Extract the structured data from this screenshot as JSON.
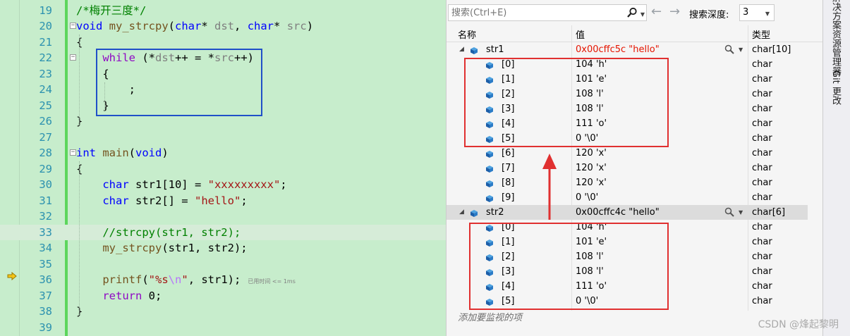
{
  "editor": {
    "lines": [
      {
        "n": "19",
        "html": "<span class='cm'>/*梅开三度*/</span>"
      },
      {
        "n": "20",
        "html": "<span class='kw'>void</span> <span class='fn'>my_strcpy</span>(<span class='kw'>char</span>* <span class='id'>dst</span>, <span class='kw'>char</span>* <span class='id'>src</span>)"
      },
      {
        "n": "21",
        "html": "{"
      },
      {
        "n": "22",
        "html": "    <span class='kw2'>while</span> (*<span class='id'>dst</span>++ = *<span class='id'>src</span>++)"
      },
      {
        "n": "23",
        "html": "    {"
      },
      {
        "n": "24",
        "html": "        ;"
      },
      {
        "n": "25",
        "html": "    }"
      },
      {
        "n": "26",
        "html": "}"
      },
      {
        "n": "27",
        "html": ""
      },
      {
        "n": "28",
        "html": "<span class='kw'>int</span> <span class='fn'>main</span>(<span class='kw'>void</span>)"
      },
      {
        "n": "29",
        "html": "{"
      },
      {
        "n": "30",
        "html": "    <span class='kw'>char</span> str1[10] = <span class='str'>\"xxxxxxxxx\"</span>;"
      },
      {
        "n": "31",
        "html": "    <span class='kw'>char</span> str2[] = <span class='str'>\"hello\"</span>;"
      },
      {
        "n": "32",
        "html": ""
      },
      {
        "n": "33",
        "html": "    <span class='cm'>//strcpy(str1, str2);</span>"
      },
      {
        "n": "34",
        "html": "    <span class='fn'>my_strcpy</span>(str1, str2);"
      },
      {
        "n": "35",
        "html": ""
      },
      {
        "n": "36",
        "html": "    <span class='fn'>printf</span>(<span class='str'>\"%s<span class='esc'>\\n</span>\"</span>, str1);<span class='hint'>已用时间 &lt;= 1ms</span>"
      },
      {
        "n": "37",
        "html": "    <span class='kw2'>return</span> 0;"
      },
      {
        "n": "38",
        "html": "}"
      },
      {
        "n": "39",
        "html": ""
      }
    ]
  },
  "watch": {
    "search_placeholder": "搜索(Ctrl+E)",
    "depth_label": "搜索深度:",
    "depth_value": "3",
    "columns": {
      "name": "名称",
      "value": "值",
      "type": "类型"
    },
    "rows": [
      {
        "level": 0,
        "name": "str1",
        "value": "0x00cffc5c \"hello\"",
        "type": "char[10]",
        "changed": true,
        "expanded": true,
        "selected": false
      },
      {
        "level": 1,
        "name": "[0]",
        "value": "104 'h'",
        "type": "char"
      },
      {
        "level": 1,
        "name": "[1]",
        "value": "101 'e'",
        "type": "char"
      },
      {
        "level": 1,
        "name": "[2]",
        "value": "108 'l'",
        "type": "char"
      },
      {
        "level": 1,
        "name": "[3]",
        "value": "108 'l'",
        "type": "char"
      },
      {
        "level": 1,
        "name": "[4]",
        "value": "111 'o'",
        "type": "char"
      },
      {
        "level": 1,
        "name": "[5]",
        "value": "0 '\\0'",
        "type": "char"
      },
      {
        "level": 1,
        "name": "[6]",
        "value": "120 'x'",
        "type": "char"
      },
      {
        "level": 1,
        "name": "[7]",
        "value": "120 'x'",
        "type": "char"
      },
      {
        "level": 1,
        "name": "[8]",
        "value": "120 'x'",
        "type": "char"
      },
      {
        "level": 1,
        "name": "[9]",
        "value": "0 '\\0'",
        "type": "char"
      },
      {
        "level": 0,
        "name": "str2",
        "value": "0x00cffc4c \"hello\"",
        "type": "char[6]",
        "changed": false,
        "expanded": true,
        "selected": true
      },
      {
        "level": 1,
        "name": "[0]",
        "value": "104 'h'",
        "type": "char"
      },
      {
        "level": 1,
        "name": "[1]",
        "value": "101 'e'",
        "type": "char"
      },
      {
        "level": 1,
        "name": "[2]",
        "value": "108 'l'",
        "type": "char"
      },
      {
        "level": 1,
        "name": "[3]",
        "value": "108 'l'",
        "type": "char"
      },
      {
        "level": 1,
        "name": "[4]",
        "value": "111 'o'",
        "type": "char"
      },
      {
        "level": 1,
        "name": "[5]",
        "value": "0 '\\0'",
        "type": "char"
      }
    ],
    "add_watch": "添加要监视的项"
  },
  "side_tabs": [
    "解决方案资源管理器",
    "Git 更改"
  ],
  "watermark": "CSDN @烽起黎明",
  "colors": {
    "changed_value": "#e51400",
    "annotation_red": "#e03030",
    "annotation_blue": "#2050c8",
    "editor_bg": "#c7edcc"
  }
}
